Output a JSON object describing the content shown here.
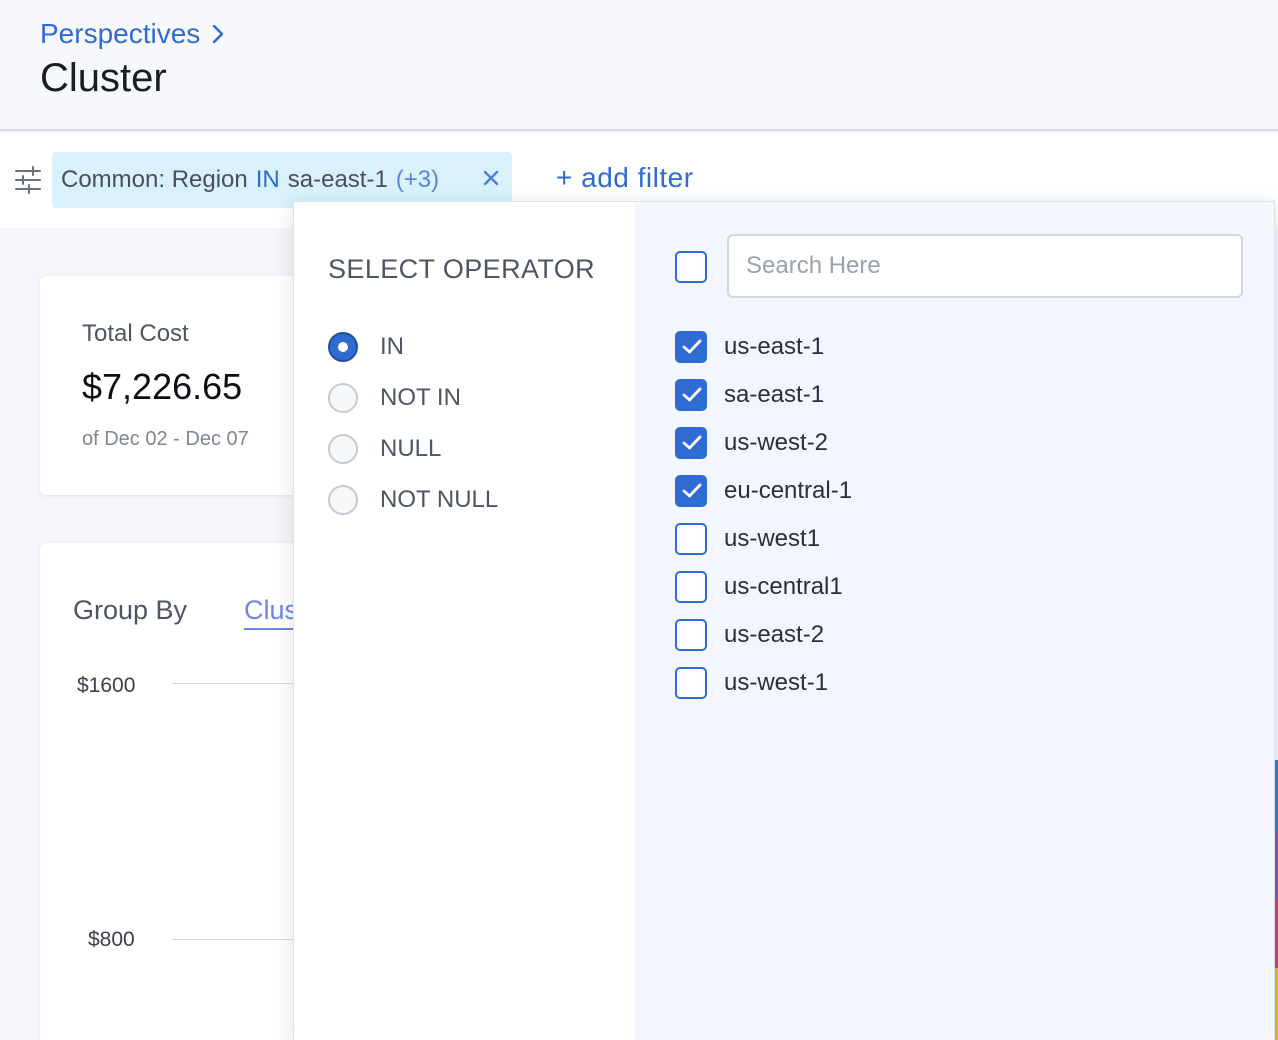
{
  "header": {
    "breadcrumb": "Perspectives",
    "title": "Cluster"
  },
  "filter_bar": {
    "chip": {
      "field": "Common: Region",
      "operator": "IN",
      "value": "sa-east-1",
      "more": "(+3)"
    },
    "add_filter_label": "+ add filter"
  },
  "cost_card": {
    "label": "Total Cost",
    "value": "$7,226.65",
    "period": "of Dec 02 - Dec 07"
  },
  "chart_card": {
    "group_by_label": "Group By",
    "group_by_value": "Clus",
    "y_ticks": [
      "$1600",
      "$800"
    ]
  },
  "popover": {
    "operator_title": "SELECT OPERATOR",
    "operators": [
      {
        "label": "IN",
        "checked": true
      },
      {
        "label": "NOT IN",
        "checked": false
      },
      {
        "label": "NULL",
        "checked": false
      },
      {
        "label": "NOT NULL",
        "checked": false
      }
    ],
    "search_placeholder": "Search Here",
    "search_value": "",
    "options": [
      {
        "label": "us-east-1",
        "checked": true
      },
      {
        "label": "sa-east-1",
        "checked": true
      },
      {
        "label": "us-west-2",
        "checked": true
      },
      {
        "label": "eu-central-1",
        "checked": true
      },
      {
        "label": "us-west1",
        "checked": false
      },
      {
        "label": "us-central1",
        "checked": false
      },
      {
        "label": "us-east-2",
        "checked": false
      },
      {
        "label": "us-west-1",
        "checked": false
      }
    ]
  },
  "colors": {
    "accent": "#2f6bd0",
    "chip_bg": "#d8f1fb",
    "popover_right_bg": "#f3f6fc",
    "stripes": [
      "#2f7fd6",
      "#7e57c2",
      "#d63f7a",
      "#f0b429"
    ]
  },
  "icons": {
    "breadcrumb": "chevron-right-icon",
    "filter": "sliders-icon",
    "chip_close": "close-icon",
    "checkbox": "check-icon"
  }
}
